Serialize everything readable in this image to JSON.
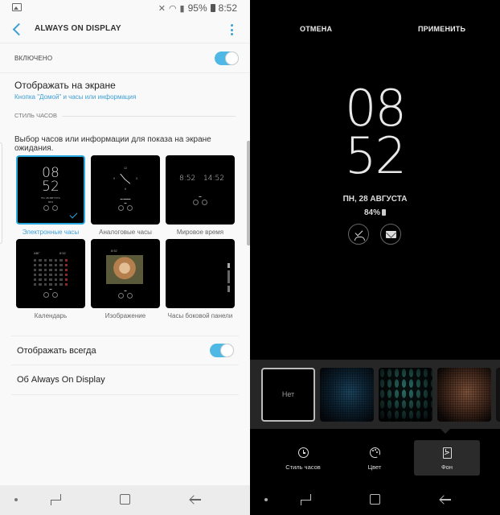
{
  "left": {
    "status_bar": {
      "battery": "95%",
      "time": "8:52",
      "icons": [
        "gallery-notification-icon",
        "mute-vibrate-icon",
        "wifi-icon",
        "signal-icon",
        "battery-icon"
      ]
    },
    "app_bar": {
      "title": "ALWAYS ON DISPLAY",
      "back_icon": "back-chevron-icon",
      "menu_icon": "more-vertical-icon"
    },
    "master_switch": {
      "label": "ВКЛЮЧЕНО",
      "on": true
    },
    "display_on_screen": {
      "title": "Отображать на экране",
      "subtitle": "Кнопка \"Домой\" и часы или информация"
    },
    "clock_style": {
      "section_label": "СТИЛЬ ЧАСОВ",
      "description": "Выбор часов или информации для показа на экране ожидания.",
      "options": [
        {
          "label": "Электронные часы",
          "selected": true,
          "preview_time": [
            "08",
            "52"
          ],
          "preview_date": "ПН, 28 АВГУСТА",
          "preview_battery": "84%"
        },
        {
          "label": "Аналоговые часы",
          "selected": false,
          "dial_numbers": [
            "12",
            "3",
            "6",
            "9"
          ]
        },
        {
          "label": "Мировое время",
          "selected": false,
          "times": [
            "8:52",
            "14:52"
          ]
        },
        {
          "label": "Календарь",
          "selected": false,
          "month": "АВГ",
          "time": "8:52"
        },
        {
          "label": "Изображение",
          "selected": false,
          "time": "8:52"
        },
        {
          "label": "Часы боковой панели",
          "selected": false
        }
      ]
    },
    "always_show": {
      "label": "Отображать всегда",
      "on": true
    },
    "about": {
      "label": "Об Always On Display"
    }
  },
  "right": {
    "actions": {
      "cancel": "ОТМЕНА",
      "apply": "ПРИМЕНИТЬ"
    },
    "preview": {
      "hours": "08",
      "minutes": "52",
      "date": "ПН, 28 АВГУСТА",
      "battery": "84%",
      "notification_icons": [
        "missed-call-icon",
        "message-icon"
      ]
    },
    "backgrounds": [
      {
        "name": "none",
        "label": "Нет",
        "selected": true
      },
      {
        "name": "blue-hex-pattern",
        "selected": false
      },
      {
        "name": "teal-scales-pattern",
        "selected": false
      },
      {
        "name": "copper-dots-pattern",
        "selected": false
      },
      {
        "name": "more-pattern",
        "selected": false
      }
    ],
    "tabs": [
      {
        "label": "Стиль часов",
        "icon": "clock-icon",
        "active": false
      },
      {
        "label": "Цвет",
        "icon": "palette-icon",
        "active": false
      },
      {
        "label": "Фон",
        "icon": "wallpaper-icon",
        "active": true
      }
    ]
  },
  "colors": {
    "accent": "#3e9fd6",
    "toggle_on": "#4fb8e5",
    "selected_border": "#29a8e0",
    "left_background": "#f9f9f9",
    "tray_background": "#262626"
  }
}
